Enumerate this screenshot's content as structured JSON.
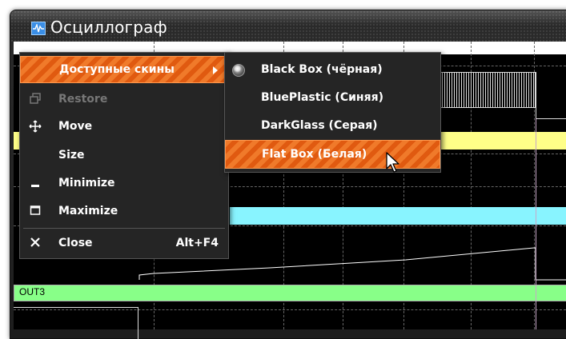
{
  "window": {
    "title": "Осциллограф",
    "icon": "oscilloscope-icon"
  },
  "scope": {
    "channel_label": "OUT3",
    "colors": {
      "yellow": "#ffff88",
      "cyan": "#88f4ff",
      "green": "#88ff88",
      "background": "#000000",
      "grid": "#666666"
    }
  },
  "context_menu": {
    "items": [
      {
        "label": "Доступные скины",
        "icon": "",
        "enabled": true,
        "highlighted": true,
        "has_submenu": true
      },
      {
        "label": "Restore",
        "icon": "restore-icon",
        "enabled": false
      },
      {
        "label": "Move",
        "icon": "move-icon",
        "enabled": true
      },
      {
        "label": "Size",
        "icon": "",
        "enabled": true
      },
      {
        "label": "Minimize",
        "icon": "minimize-icon",
        "enabled": true
      },
      {
        "label": "Maximize",
        "icon": "maximize-icon",
        "enabled": true
      },
      {
        "label": "Close",
        "icon": "close-icon",
        "enabled": true,
        "shortcut": "Alt+F4"
      }
    ]
  },
  "skins_submenu": {
    "items": [
      {
        "label": "Black Box (чёрная)",
        "selected": true
      },
      {
        "label": "BluePlastic (Синяя)",
        "selected": false
      },
      {
        "label": "DarkGlass (Серая)",
        "selected": false
      },
      {
        "label": "Flat Box (Белая)",
        "selected": false,
        "highlighted": true
      }
    ]
  },
  "accent_color": "#f07a2a"
}
